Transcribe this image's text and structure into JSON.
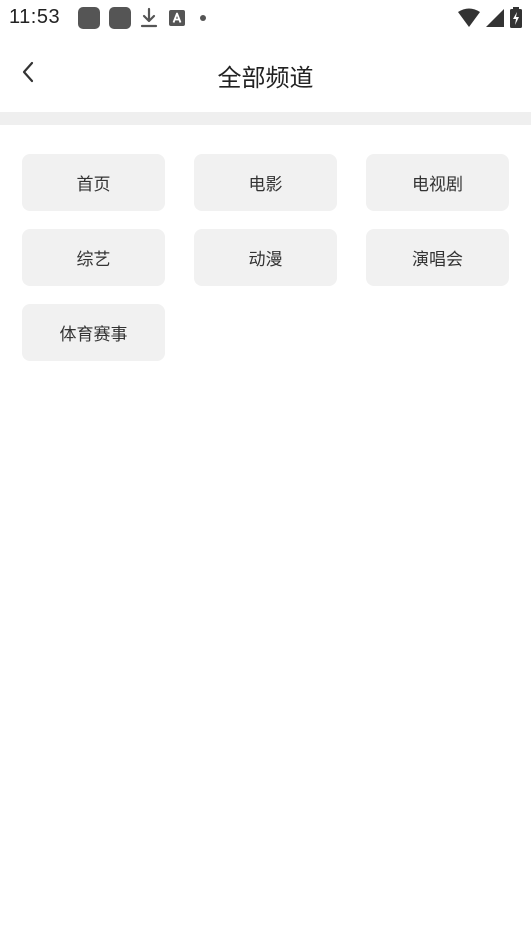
{
  "status_bar": {
    "time": "11:53",
    "icons_left": [
      "app-square-icon",
      "app-square-icon",
      "download-icon",
      "a-box-icon",
      "dot-icon"
    ],
    "icons_right": [
      "wifi-icon",
      "signal-icon",
      "battery-charging-icon"
    ]
  },
  "header": {
    "title": "全部频道",
    "back_icon": "chevron-left-icon"
  },
  "channels": [
    {
      "label": "首页"
    },
    {
      "label": "电影"
    },
    {
      "label": "电视剧"
    },
    {
      "label": "综艺"
    },
    {
      "label": "动漫"
    },
    {
      "label": "演唱会"
    },
    {
      "label": "体育赛事"
    }
  ],
  "colors": {
    "chip_bg": "#f1f1f1",
    "divider": "#efefef",
    "text": "#333333"
  }
}
